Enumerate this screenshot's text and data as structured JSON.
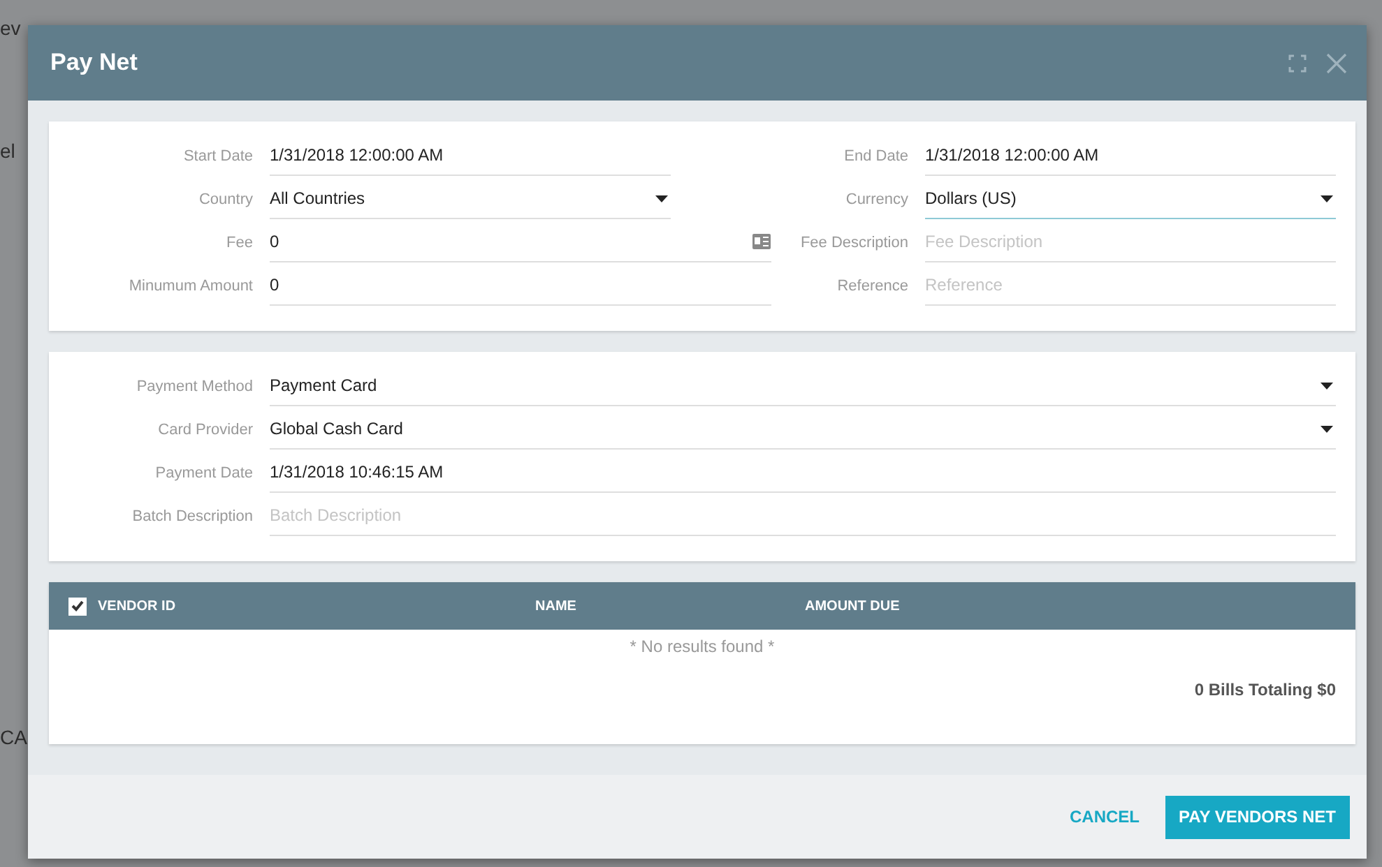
{
  "backdrop": {
    "fragments": [
      "ev",
      "el",
      "CA"
    ]
  },
  "dialog": {
    "title": "Pay Net"
  },
  "filters": [
    {
      "left": {
        "label": "Start Date",
        "kind": "text",
        "value": "1/31/2018 12:00:00 AM"
      },
      "right": {
        "label": "End Date",
        "kind": "text",
        "value": "1/31/2018 12:00:00 AM"
      }
    },
    {
      "left": {
        "label": "Country",
        "kind": "select",
        "value": "All Countries"
      },
      "right": {
        "label": "Currency",
        "kind": "select",
        "value": "Dollars (US)",
        "focused": true
      }
    },
    {
      "left": {
        "label": "Fee",
        "kind": "lookup",
        "value": "0"
      },
      "right": {
        "label": "Fee Description",
        "kind": "text",
        "placeholder": "Fee Description"
      }
    },
    {
      "left": {
        "label": "Minumum Amount",
        "kind": "text",
        "value": "0"
      },
      "right": {
        "label": "Reference",
        "kind": "text",
        "placeholder": "Reference"
      }
    }
  ],
  "payment": [
    {
      "label": "Payment Method",
      "kind": "select",
      "value": "Payment Card"
    },
    {
      "label": "Card Provider",
      "kind": "select",
      "value": "Global Cash Card"
    },
    {
      "label": "Payment Date",
      "kind": "text",
      "value": "1/31/2018 10:46:15 AM"
    },
    {
      "label": "Batch Description",
      "kind": "text",
      "placeholder": "Batch Description"
    }
  ],
  "table": {
    "select_all": true,
    "columns": [
      "VENDOR ID",
      "NAME",
      "AMOUNT DUE"
    ],
    "empty_message": "* No results found *",
    "total": "0 Bills Totaling $0"
  },
  "buttons": [
    {
      "label": "CANCEL",
      "kind": "flat"
    },
    {
      "label": "PAY VENDORS NET",
      "kind": "primary"
    }
  ]
}
